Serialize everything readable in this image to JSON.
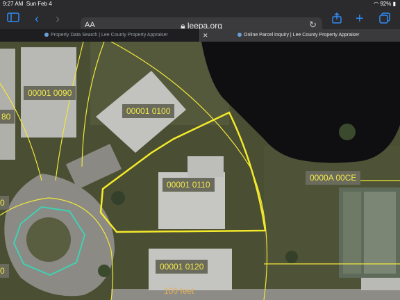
{
  "status": {
    "time": "9:27 AM",
    "date": "Sun Feb 4",
    "battery": "92%"
  },
  "toolbar": {
    "text_size": "AA",
    "url": "leepa.org"
  },
  "tabs": [
    {
      "label": "Property Data Search | Lee County Property Appraiser"
    },
    {
      "label": "Online Parcel Inquiry | Lee County Property Appraiser"
    }
  ],
  "map": {
    "parcels": [
      {
        "label": "00001 0090"
      },
      {
        "label": "00001 0100"
      },
      {
        "label": "00001 0110"
      },
      {
        "label": "0000A 00CE"
      },
      {
        "label": "00001 0120"
      },
      {
        "label": "80"
      },
      {
        "label": "0"
      },
      {
        "label": "0"
      }
    ],
    "scale_label": "100 feet"
  },
  "colors": {
    "parcel_line": "#f1e83a",
    "selected": "#f5ea2a",
    "water": "#0f0f12",
    "teal": "#3fd2b4",
    "tab_accent": "#2f8cf6"
  }
}
